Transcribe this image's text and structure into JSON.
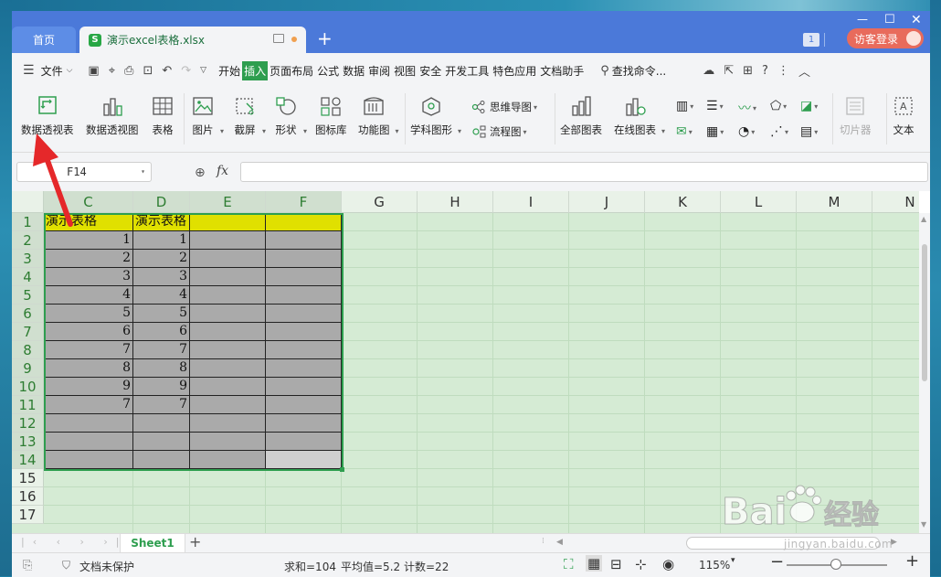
{
  "window": {
    "tabs": [
      {
        "label": "首页"
      },
      {
        "label": "演示excel表格.xlsx",
        "icon": "S"
      }
    ],
    "badge": "1",
    "login_label": "访客登录"
  },
  "menubar": {
    "file_label": "文件",
    "items": [
      "开始",
      "插入",
      "页面布局",
      "公式",
      "数据",
      "审阅",
      "视图",
      "安全",
      "开发工具",
      "特色应用",
      "文档助手"
    ],
    "active_item": "插入",
    "search_label": "查找命令..."
  },
  "ribbon": {
    "buttons": {
      "pivot_table": "数据透视表",
      "pivot_chart": "数据透视图",
      "table": "表格",
      "picture": "图片",
      "screenshot": "截屏",
      "shapes": "形状",
      "icon_library": "图标库",
      "function_chart": "功能图",
      "subject_shapes": "学科图形",
      "mind_map": "思维导图",
      "flowchart": "流程图",
      "all_charts": "全部图表",
      "online_charts": "在线图表",
      "slicer": "切片器",
      "textbox": "文本"
    }
  },
  "formula_bar": {
    "name_box": "F14",
    "fx_label": "fx",
    "formula": ""
  },
  "sheet": {
    "columns": [
      "C",
      "D",
      "E",
      "F",
      "G",
      "H",
      "I",
      "J",
      "K",
      "L",
      "M",
      "N"
    ],
    "rows": [
      "1",
      "2",
      "3",
      "4",
      "5",
      "6",
      "7",
      "8",
      "9",
      "10",
      "11",
      "12",
      "13",
      "14",
      "15",
      "16",
      "17"
    ],
    "header_row": {
      "C": "演示表格",
      "D": "演示表格",
      "E": "",
      "F": ""
    },
    "data_c": [
      "1",
      "2",
      "3",
      "4",
      "5",
      "6",
      "7",
      "8",
      "9",
      "7"
    ],
    "data_d": [
      "1",
      "2",
      "3",
      "4",
      "5",
      "6",
      "7",
      "8",
      "9",
      "7"
    ],
    "tab_name": "Sheet1"
  },
  "statusbar": {
    "protect_label": "文档未保护",
    "sum": "求和=104",
    "average": "平均值=5.2",
    "count": "计数=22",
    "zoom": "115%"
  },
  "watermark": {
    "brand_left": "Bai",
    "brand_right": "经验",
    "url": "jingyan.baidu.com"
  },
  "colors": {
    "title_blue": "#4b79d9",
    "accent_green": "#2e9e4f",
    "header_yellow": "#e0e000",
    "cell_gray": "#aaaaaa",
    "eye_protect_green": "#d5ebd4",
    "login_red": "#e86b5c",
    "annotation_red": "#e5282a"
  }
}
